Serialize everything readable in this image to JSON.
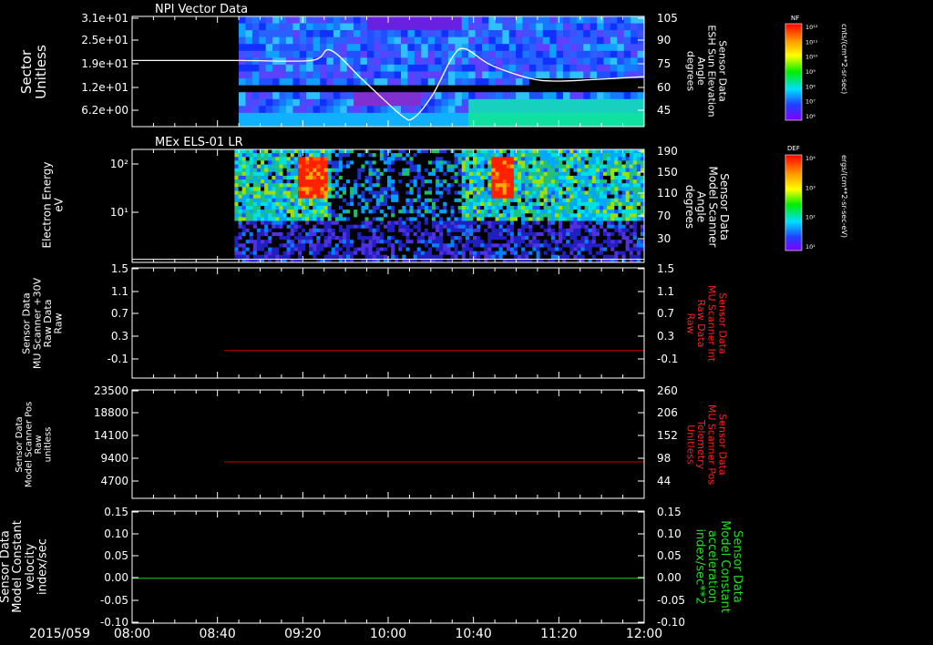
{
  "date_label": "2015/059",
  "time_ticks": [
    "08:00",
    "08:40",
    "09:20",
    "10:00",
    "10:40",
    "11:20",
    "12:00"
  ],
  "time_range_hours": [
    8,
    12
  ],
  "chart_data": [
    {
      "type": "heatmap",
      "title": "NPI Vector Data",
      "ylabel": [
        "Sector",
        "Unitless"
      ],
      "yticks": [
        "3.1e+01",
        "2.5e+01",
        "1.9e+01",
        "1.2e+01",
        "6.2e+00"
      ],
      "y2label": [
        "Sensor Data",
        "ESH Sun Elevation",
        "Angle",
        "degrees"
      ],
      "y2ticks": [
        "105",
        "90",
        "75",
        "60",
        "45"
      ],
      "y2lim": [
        30,
        105
      ],
      "data_start_hour": 8.833,
      "colorbar": {
        "label": "NF",
        "units": "cnts/(cm**2-sr-sec)",
        "ticks": [
          "10¹²",
          "10¹¹",
          "10¹⁰",
          "10⁹",
          "10⁸",
          "10⁷",
          "10⁶"
        ]
      },
      "series": [
        {
          "type": "line",
          "color": "#ffffff",
          "hours": [
            8.0,
            8.83,
            9.4,
            9.55,
            9.8,
            10.1,
            10.2,
            10.35,
            10.5,
            10.6,
            10.8,
            11.1,
            11.3,
            11.6,
            12.0
          ],
          "values": [
            75,
            75,
            75,
            82,
            62,
            38,
            36,
            52,
            77,
            83,
            72,
            63,
            61,
            62,
            64
          ]
        }
      ]
    },
    {
      "type": "heatmap",
      "title": "MEx ELS-01 LR",
      "ylabel": [
        "Electron Energy",
        "eV"
      ],
      "yticks": [
        "10²",
        "10¹"
      ],
      "y2label": [
        "Sensor Data",
        "Model Scanner",
        "Angle",
        "degrees"
      ],
      "y2ticks": [
        "190",
        "150",
        "110",
        "70",
        "30"
      ],
      "y2lim": [
        10,
        190
      ],
      "data_start_hour": 8.8,
      "colorbar": {
        "label": "DEF",
        "units": "ergs/(cm**2-sr-sec-eV)",
        "ticks": [
          "10⁴",
          "10³",
          "10²",
          "10¹"
        ]
      },
      "series": [
        {
          "type": "line",
          "color": "#ffffff",
          "hours": [
            8.0,
            12.0
          ],
          "values": [
            15,
            15
          ]
        }
      ]
    },
    {
      "type": "line",
      "ylabel": [
        "Sensor Data",
        "MU Scanner +30V",
        "Raw Data",
        "Raw"
      ],
      "yticks": [
        "1.5",
        "1.1",
        "0.7",
        "0.3",
        "-0.1"
      ],
      "ylim": [
        -0.5,
        1.5
      ],
      "y2label": [
        "Sensor Data",
        "MU Scanner Int",
        "Raw Data",
        "Raw"
      ],
      "y2ticks": [
        "1.5",
        "1.1",
        "0.7",
        "0.3",
        "-0.1"
      ],
      "y2color": "#ff2020",
      "series": [
        {
          "color": "#cc0000",
          "hours": [
            8.72,
            12.0
          ],
          "values": [
            0.0,
            0.0
          ]
        }
      ]
    },
    {
      "type": "line",
      "ylabel": [
        "Sensor Data",
        "Model Scanner Pos",
        "Raw",
        "unitless"
      ],
      "yticks": [
        "23500",
        "18800",
        "14100",
        "9400",
        "4700"
      ],
      "ylim": [
        0,
        23500
      ],
      "y2label": [
        "Sensor Data",
        "MU Scanner Pos",
        "Telemetry",
        "Unitless"
      ],
      "y2ticks": [
        "260",
        "206",
        "152",
        "98",
        "44"
      ],
      "y2color": "#ff2020",
      "series": [
        {
          "color": "#cc0000",
          "hours": [
            8.72,
            12.0
          ],
          "values": [
            7900,
            7900
          ]
        }
      ]
    },
    {
      "type": "line",
      "ylabel": [
        "Sensor Data",
        "Model Constant",
        "velocity",
        "index/sec"
      ],
      "yticks": [
        "0.15",
        "0.10",
        "0.05",
        "0.00",
        "-0.05",
        "-0.10"
      ],
      "ylim": [
        -0.1,
        0.15
      ],
      "y2label": [
        "Sensor Data",
        "Model Constant",
        "acceleration",
        "index/sec**2"
      ],
      "y2ticks": [
        "0.15",
        "0.10",
        "0.05",
        "0.00",
        "-0.05",
        "-0.10"
      ],
      "y2color": "#22dd22",
      "series": [
        {
          "color": "#22cc22",
          "hours": [
            8.0,
            12.0
          ],
          "values": [
            0.0,
            0.0
          ]
        }
      ]
    }
  ]
}
